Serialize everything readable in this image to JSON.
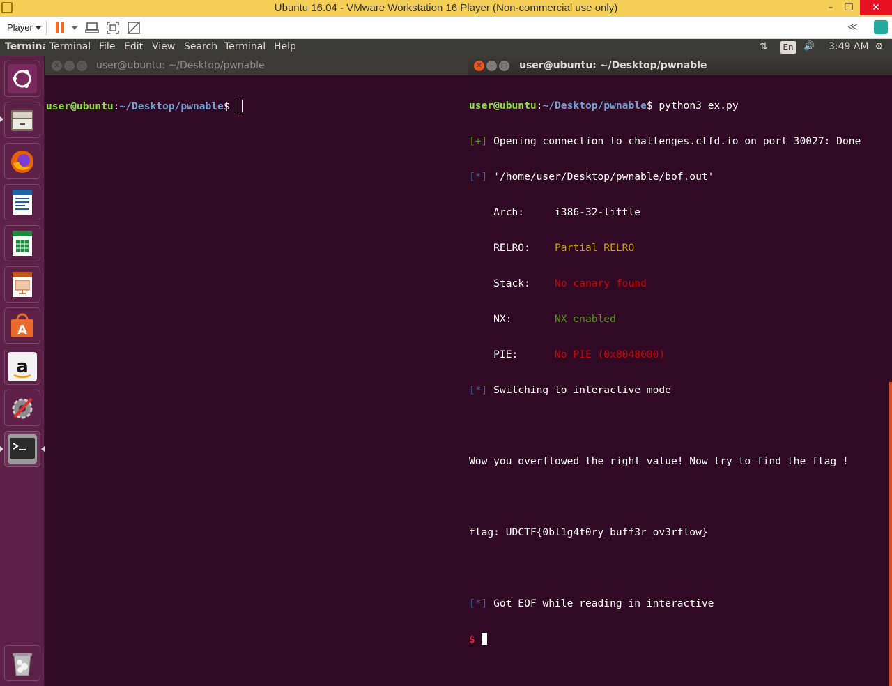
{
  "vm": {
    "title": "Ubuntu 16.04 - VMware Workstation 16 Player (Non-commercial use only)",
    "player_label": "Player",
    "minimize": "–",
    "restore": "❐",
    "close": "✕",
    "collapse_icon": "≪"
  },
  "panel": {
    "app_name": "Terminal",
    "menus": [
      "Terminal",
      "File",
      "Edit",
      "View",
      "Search",
      "Terminal",
      "Help"
    ],
    "language": "En",
    "time": "3:49 AM",
    "network_icon": "⇅",
    "volume_icon": "🔊",
    "settings_icon": "⚙"
  },
  "launcher": {
    "items": [
      {
        "name": "ubuntu-dash-icon",
        "color": "#7a2a5e"
      },
      {
        "name": "files-icon",
        "color": "#6b5f50"
      },
      {
        "name": "firefox-icon",
        "color": "#e66000"
      },
      {
        "name": "writer-icon",
        "color": "#1e63a8"
      },
      {
        "name": "calc-icon",
        "color": "#1d8a3c"
      },
      {
        "name": "impress-icon",
        "color": "#c2561a"
      },
      {
        "name": "software-center-icon",
        "color": "#e8692b"
      },
      {
        "name": "amazon-icon",
        "color": "#f2f2f2"
      },
      {
        "name": "system-settings-icon",
        "color": "#6a6a6a"
      },
      {
        "name": "terminal-icon",
        "color": "#2b2b2b"
      },
      {
        "name": "trash-icon",
        "color": "#8c8c8c"
      }
    ]
  },
  "left_terminal": {
    "title": "user@ubuntu: ~/Desktop/pwnable",
    "prompt_user": "user@ubuntu",
    "prompt_path": "~/Desktop/pwnable",
    "prompt_symbol": "$ "
  },
  "right_terminal": {
    "title": "user@ubuntu: ~/Desktop/pwnable",
    "prompt_user": "user@ubuntu",
    "prompt_path": "~/Desktop/pwnable",
    "command": "$ python3 ex.py",
    "lines": {
      "l1_tag": "[+]",
      "l1_text": " Opening connection to challenges.ctfd.io on port 30027: Done",
      "l2_tag": "[*]",
      "l2_text": " '/home/user/Desktop/pwnable/bof.out'",
      "arch_label": "    Arch:     ",
      "arch_value": "i386-32-little",
      "relro_label": "    RELRO:    ",
      "relro_value": "Partial RELRO",
      "stack_label": "    Stack:    ",
      "stack_value": "No canary found",
      "nx_label": "    NX:       ",
      "nx_value": "NX enabled",
      "pie_label": "    PIE:      ",
      "pie_value": "No PIE (0x8048000)",
      "l3_tag": "[*]",
      "l3_text": " Switching to interactive mode",
      "wow": "Wow you overflowed the right value! Now try to find the flag !",
      "flag": "flag: UDCTF{0bl1g4t0ry_buff3r_ov3rflow}",
      "l4_tag": "[*]",
      "l4_text": " Got EOF while reading in interactive",
      "final_prompt": "$ "
    }
  }
}
